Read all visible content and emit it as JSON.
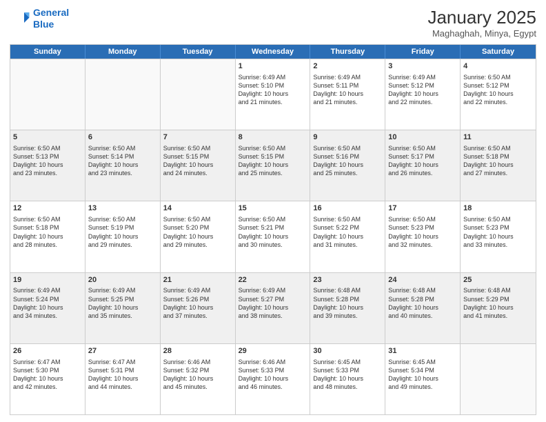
{
  "logo": {
    "line1": "General",
    "line2": "Blue"
  },
  "title": "January 2025",
  "location": "Maghaghah, Minya, Egypt",
  "days_of_week": [
    "Sunday",
    "Monday",
    "Tuesday",
    "Wednesday",
    "Thursday",
    "Friday",
    "Saturday"
  ],
  "weeks": [
    [
      {
        "num": "",
        "lines": [],
        "empty": true
      },
      {
        "num": "",
        "lines": [],
        "empty": true
      },
      {
        "num": "",
        "lines": [],
        "empty": true
      },
      {
        "num": "1",
        "lines": [
          "Sunrise: 6:49 AM",
          "Sunset: 5:10 PM",
          "Daylight: 10 hours",
          "and 21 minutes."
        ],
        "empty": false
      },
      {
        "num": "2",
        "lines": [
          "Sunrise: 6:49 AM",
          "Sunset: 5:11 PM",
          "Daylight: 10 hours",
          "and 21 minutes."
        ],
        "empty": false
      },
      {
        "num": "3",
        "lines": [
          "Sunrise: 6:49 AM",
          "Sunset: 5:12 PM",
          "Daylight: 10 hours",
          "and 22 minutes."
        ],
        "empty": false
      },
      {
        "num": "4",
        "lines": [
          "Sunrise: 6:50 AM",
          "Sunset: 5:12 PM",
          "Daylight: 10 hours",
          "and 22 minutes."
        ],
        "empty": false
      }
    ],
    [
      {
        "num": "5",
        "lines": [
          "Sunrise: 6:50 AM",
          "Sunset: 5:13 PM",
          "Daylight: 10 hours",
          "and 23 minutes."
        ],
        "empty": false
      },
      {
        "num": "6",
        "lines": [
          "Sunrise: 6:50 AM",
          "Sunset: 5:14 PM",
          "Daylight: 10 hours",
          "and 23 minutes."
        ],
        "empty": false
      },
      {
        "num": "7",
        "lines": [
          "Sunrise: 6:50 AM",
          "Sunset: 5:15 PM",
          "Daylight: 10 hours",
          "and 24 minutes."
        ],
        "empty": false
      },
      {
        "num": "8",
        "lines": [
          "Sunrise: 6:50 AM",
          "Sunset: 5:15 PM",
          "Daylight: 10 hours",
          "and 25 minutes."
        ],
        "empty": false
      },
      {
        "num": "9",
        "lines": [
          "Sunrise: 6:50 AM",
          "Sunset: 5:16 PM",
          "Daylight: 10 hours",
          "and 25 minutes."
        ],
        "empty": false
      },
      {
        "num": "10",
        "lines": [
          "Sunrise: 6:50 AM",
          "Sunset: 5:17 PM",
          "Daylight: 10 hours",
          "and 26 minutes."
        ],
        "empty": false
      },
      {
        "num": "11",
        "lines": [
          "Sunrise: 6:50 AM",
          "Sunset: 5:18 PM",
          "Daylight: 10 hours",
          "and 27 minutes."
        ],
        "empty": false
      }
    ],
    [
      {
        "num": "12",
        "lines": [
          "Sunrise: 6:50 AM",
          "Sunset: 5:18 PM",
          "Daylight: 10 hours",
          "and 28 minutes."
        ],
        "empty": false
      },
      {
        "num": "13",
        "lines": [
          "Sunrise: 6:50 AM",
          "Sunset: 5:19 PM",
          "Daylight: 10 hours",
          "and 29 minutes."
        ],
        "empty": false
      },
      {
        "num": "14",
        "lines": [
          "Sunrise: 6:50 AM",
          "Sunset: 5:20 PM",
          "Daylight: 10 hours",
          "and 29 minutes."
        ],
        "empty": false
      },
      {
        "num": "15",
        "lines": [
          "Sunrise: 6:50 AM",
          "Sunset: 5:21 PM",
          "Daylight: 10 hours",
          "and 30 minutes."
        ],
        "empty": false
      },
      {
        "num": "16",
        "lines": [
          "Sunrise: 6:50 AM",
          "Sunset: 5:22 PM",
          "Daylight: 10 hours",
          "and 31 minutes."
        ],
        "empty": false
      },
      {
        "num": "17",
        "lines": [
          "Sunrise: 6:50 AM",
          "Sunset: 5:23 PM",
          "Daylight: 10 hours",
          "and 32 minutes."
        ],
        "empty": false
      },
      {
        "num": "18",
        "lines": [
          "Sunrise: 6:50 AM",
          "Sunset: 5:23 PM",
          "Daylight: 10 hours",
          "and 33 minutes."
        ],
        "empty": false
      }
    ],
    [
      {
        "num": "19",
        "lines": [
          "Sunrise: 6:49 AM",
          "Sunset: 5:24 PM",
          "Daylight: 10 hours",
          "and 34 minutes."
        ],
        "empty": false
      },
      {
        "num": "20",
        "lines": [
          "Sunrise: 6:49 AM",
          "Sunset: 5:25 PM",
          "Daylight: 10 hours",
          "and 35 minutes."
        ],
        "empty": false
      },
      {
        "num": "21",
        "lines": [
          "Sunrise: 6:49 AM",
          "Sunset: 5:26 PM",
          "Daylight: 10 hours",
          "and 37 minutes."
        ],
        "empty": false
      },
      {
        "num": "22",
        "lines": [
          "Sunrise: 6:49 AM",
          "Sunset: 5:27 PM",
          "Daylight: 10 hours",
          "and 38 minutes."
        ],
        "empty": false
      },
      {
        "num": "23",
        "lines": [
          "Sunrise: 6:48 AM",
          "Sunset: 5:28 PM",
          "Daylight: 10 hours",
          "and 39 minutes."
        ],
        "empty": false
      },
      {
        "num": "24",
        "lines": [
          "Sunrise: 6:48 AM",
          "Sunset: 5:28 PM",
          "Daylight: 10 hours",
          "and 40 minutes."
        ],
        "empty": false
      },
      {
        "num": "25",
        "lines": [
          "Sunrise: 6:48 AM",
          "Sunset: 5:29 PM",
          "Daylight: 10 hours",
          "and 41 minutes."
        ],
        "empty": false
      }
    ],
    [
      {
        "num": "26",
        "lines": [
          "Sunrise: 6:47 AM",
          "Sunset: 5:30 PM",
          "Daylight: 10 hours",
          "and 42 minutes."
        ],
        "empty": false
      },
      {
        "num": "27",
        "lines": [
          "Sunrise: 6:47 AM",
          "Sunset: 5:31 PM",
          "Daylight: 10 hours",
          "and 44 minutes."
        ],
        "empty": false
      },
      {
        "num": "28",
        "lines": [
          "Sunrise: 6:46 AM",
          "Sunset: 5:32 PM",
          "Daylight: 10 hours",
          "and 45 minutes."
        ],
        "empty": false
      },
      {
        "num": "29",
        "lines": [
          "Sunrise: 6:46 AM",
          "Sunset: 5:33 PM",
          "Daylight: 10 hours",
          "and 46 minutes."
        ],
        "empty": false
      },
      {
        "num": "30",
        "lines": [
          "Sunrise: 6:45 AM",
          "Sunset: 5:33 PM",
          "Daylight: 10 hours",
          "and 48 minutes."
        ],
        "empty": false
      },
      {
        "num": "31",
        "lines": [
          "Sunrise: 6:45 AM",
          "Sunset: 5:34 PM",
          "Daylight: 10 hours",
          "and 49 minutes."
        ],
        "empty": false
      },
      {
        "num": "",
        "lines": [],
        "empty": true
      }
    ]
  ]
}
